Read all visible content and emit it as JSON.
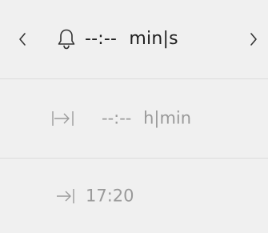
{
  "countdown": {
    "value": "--:--",
    "unit": "min|s",
    "bell_icon": "bell-icon",
    "prev_icon": "chevron-left-icon",
    "next_icon": "chevron-right-icon"
  },
  "duration": {
    "icon": "span-arrow-icon",
    "value": "--:--",
    "unit": "h|min"
  },
  "arrival": {
    "icon": "arrow-to-end-icon",
    "value": "17:20"
  },
  "colors": {
    "background": "#f0f0f0",
    "primary_text": "#1e1e1e",
    "secondary_text": "#9a9a9a",
    "divider": "#dcdcdc"
  }
}
